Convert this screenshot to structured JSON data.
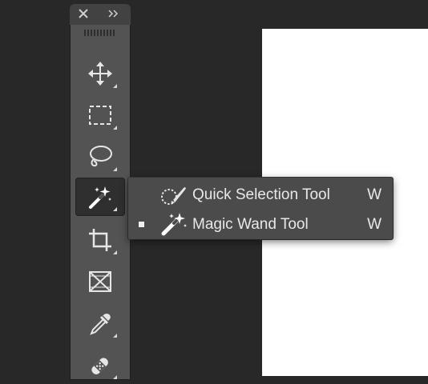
{
  "toolbar": {
    "close_icon": "close-icon",
    "collapse_icon": "double-chevron-right-icon",
    "tools": [
      {
        "icon": "move-icon"
      },
      {
        "icon": "marquee-icon"
      },
      {
        "icon": "lasso-icon"
      },
      {
        "icon": "magic-wand-icon",
        "active": true
      },
      {
        "icon": "crop-icon"
      },
      {
        "icon": "frame-icon"
      },
      {
        "icon": "eyedropper-icon"
      },
      {
        "icon": "healing-brush-icon"
      }
    ]
  },
  "flyout": {
    "items": [
      {
        "label": "Quick Selection Tool",
        "shortcut": "W",
        "icon": "quick-selection-icon",
        "selected": false
      },
      {
        "label": "Magic Wand Tool",
        "shortcut": "W",
        "icon": "magic-wand-icon",
        "selected": true
      }
    ]
  },
  "colors": {
    "workspace": "#282828",
    "toolbar": "#535353",
    "active_tool": "#2f2f2f",
    "flyout": "#4b4b4b",
    "canvas": "#ffffff"
  }
}
